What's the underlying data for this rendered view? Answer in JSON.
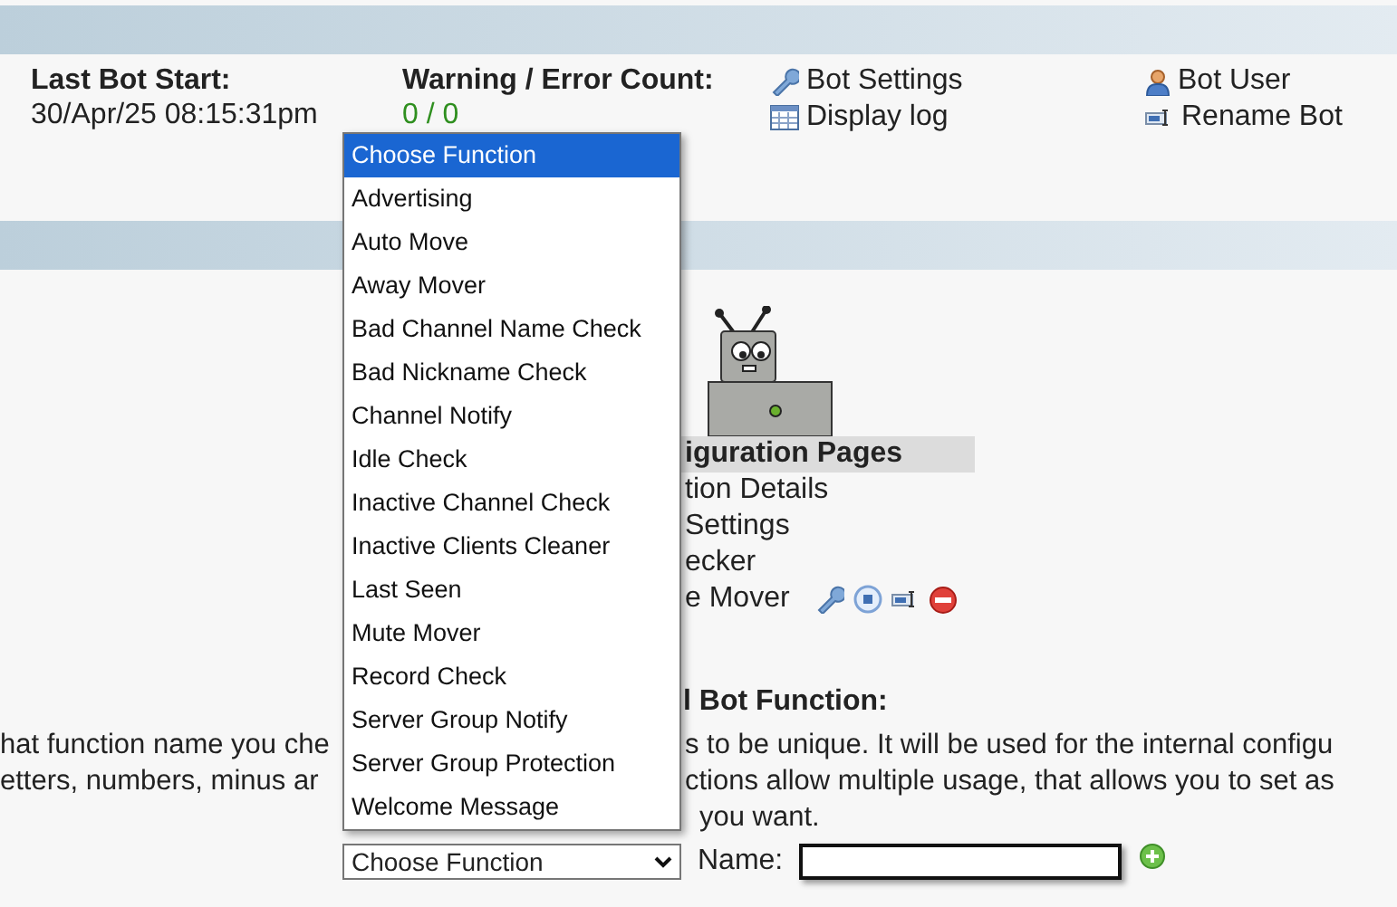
{
  "status": {
    "last_start": {
      "label": "Last Bot Start:",
      "value": "30/Apr/25 08:15:31pm"
    },
    "warnings": {
      "label": "Warning / Error Count:",
      "value": "0 / 0"
    }
  },
  "links": [
    {
      "kind": "settings",
      "label": "Bot Settings"
    },
    {
      "kind": "user",
      "label": "Bot User"
    },
    {
      "kind": "log",
      "label": "Display log"
    },
    {
      "kind": "rename",
      "label": "Rename Bot"
    }
  ],
  "config": {
    "heading": "iguration Pages",
    "items": [
      "tion Details",
      "Settings",
      "ecker",
      "e Mover"
    ]
  },
  "add_function": {
    "heading": "l Bot Function:",
    "lines": [
      {
        "left": "hat function name you che",
        "right": "s to be unique. It will be used for the internal configu"
      },
      {
        "left": "etters, numbers, minus ar",
        "right": "ctions allow multiple usage, that allows you to set as"
      },
      {
        "right": "you want."
      }
    ],
    "select": {
      "value": "Choose Function",
      "options": [
        {
          "label": "Choose Function",
          "selected": true
        },
        {
          "label": "Advertising",
          "selected": false
        },
        {
          "label": "Auto Move",
          "selected": false
        },
        {
          "label": "Away Mover",
          "selected": false
        },
        {
          "label": "Bad Channel Name Check",
          "selected": false
        },
        {
          "label": "Bad Nickname Check",
          "selected": false
        },
        {
          "label": "Channel Notify",
          "selected": false
        },
        {
          "label": "Idle Check",
          "selected": false
        },
        {
          "label": "Inactive Channel Check",
          "selected": false
        },
        {
          "label": "Inactive Clients Cleaner",
          "selected": false
        },
        {
          "label": "Last Seen",
          "selected": false
        },
        {
          "label": "Mute Mover",
          "selected": false
        },
        {
          "label": "Record Check",
          "selected": false
        },
        {
          "label": "Server Group Notify",
          "selected": false
        },
        {
          "label": "Server Group Protection",
          "selected": false
        },
        {
          "label": "Welcome Message",
          "selected": false
        }
      ]
    },
    "name_label": "Name:"
  }
}
